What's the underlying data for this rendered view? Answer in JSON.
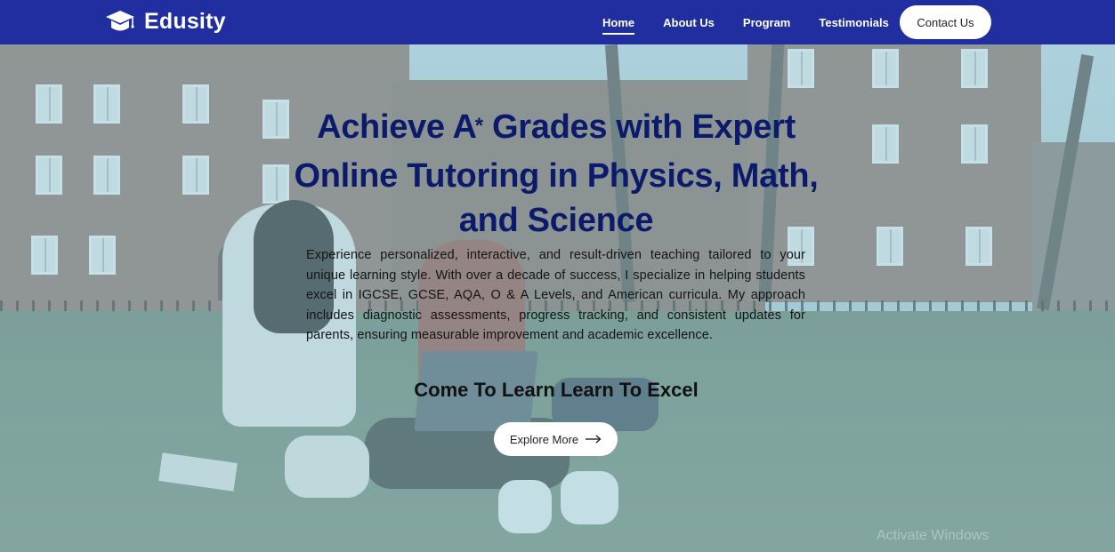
{
  "brand": {
    "name": "Edusity",
    "icon": "graduation-cap-icon"
  },
  "nav": {
    "links": [
      "Home",
      "About Us",
      "Program",
      "Testimonials"
    ],
    "active": "Home",
    "contact_label": "Contact Us"
  },
  "hero": {
    "headline_part1": "Achieve A",
    "headline_sup": "*",
    "headline_part2": " Grades with Expert Online Tutoring in Physics, Math, and Science",
    "intro": "Experience personalized, interactive, and result-driven teaching tailored to your unique learning style. With over a decade of success, I specialize in helping students excel in IGCSE, GCSE, AQA, O & A Levels, and American curricula. My approach includes diagnostic assessments, progress tracking, and consistent updates for parents, ensuring measurable improvement and academic excellence.",
    "tagline": "Come To Learn Learn To Excel",
    "cta_label": "Explore More",
    "cta_icon": "arrow-right-icon"
  },
  "watermark": "Activate Windows",
  "colors": {
    "navbar": "#212ea0",
    "headline": "#0b1a6a",
    "button_bg": "#ffffff"
  }
}
